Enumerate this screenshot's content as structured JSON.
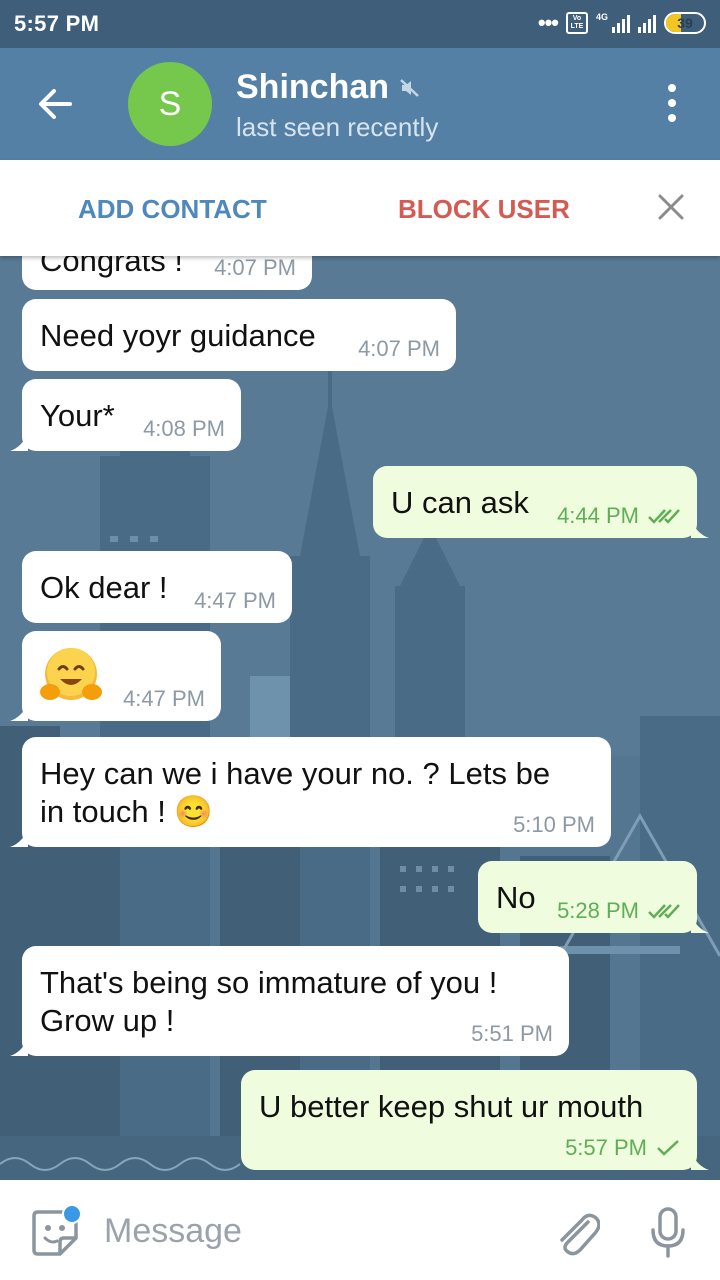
{
  "status_bar": {
    "time": "5:57 PM",
    "network": "4G",
    "battery": "39",
    "battery_level": 0.39,
    "volte": "Vo LTE"
  },
  "header": {
    "avatar_letter": "S",
    "avatar_color": "#76c84d",
    "contact_name": "Shinchan",
    "status": "last seen recently",
    "muted": true
  },
  "action_bar": {
    "add_contact": "ADD CONTACT",
    "block_user": "BLOCK USER"
  },
  "messages": [
    {
      "dir": "in",
      "text": "Congrats !",
      "time": "4:07 PM"
    },
    {
      "dir": "in",
      "text": "Need yoyr guidance",
      "time": "4:07 PM"
    },
    {
      "dir": "in",
      "text": "Your*",
      "time": "4:08 PM"
    },
    {
      "dir": "out",
      "text": "U can ask",
      "time": "4:44 PM",
      "status": "read"
    },
    {
      "dir": "in",
      "text": "Ok dear !",
      "time": "4:47 PM"
    },
    {
      "dir": "in",
      "text": "🤗",
      "time": "4:47 PM"
    },
    {
      "dir": "in",
      "text_line1": "Hey can we i have your no. ? Lets be",
      "text_line2": "in touch ! 😊",
      "time": "5:10 PM"
    },
    {
      "dir": "out",
      "text": "No",
      "time": "5:28 PM",
      "status": "read"
    },
    {
      "dir": "in",
      "text_line1": "That's being so immature of you !",
      "text_line2": "Grow up !",
      "time": "5:51 PM"
    },
    {
      "dir": "out",
      "text": "U better keep shut ur mouth",
      "time": "5:57 PM",
      "status": "sent"
    }
  ],
  "input": {
    "placeholder": "Message"
  },
  "colors": {
    "header": "#5580a5",
    "status_bar": "#3f5e79",
    "outgoing_bubble": "#effdde",
    "incoming_bubble": "#ffffff",
    "add_contact": "#4f88bd",
    "block_user": "#d45a52"
  }
}
